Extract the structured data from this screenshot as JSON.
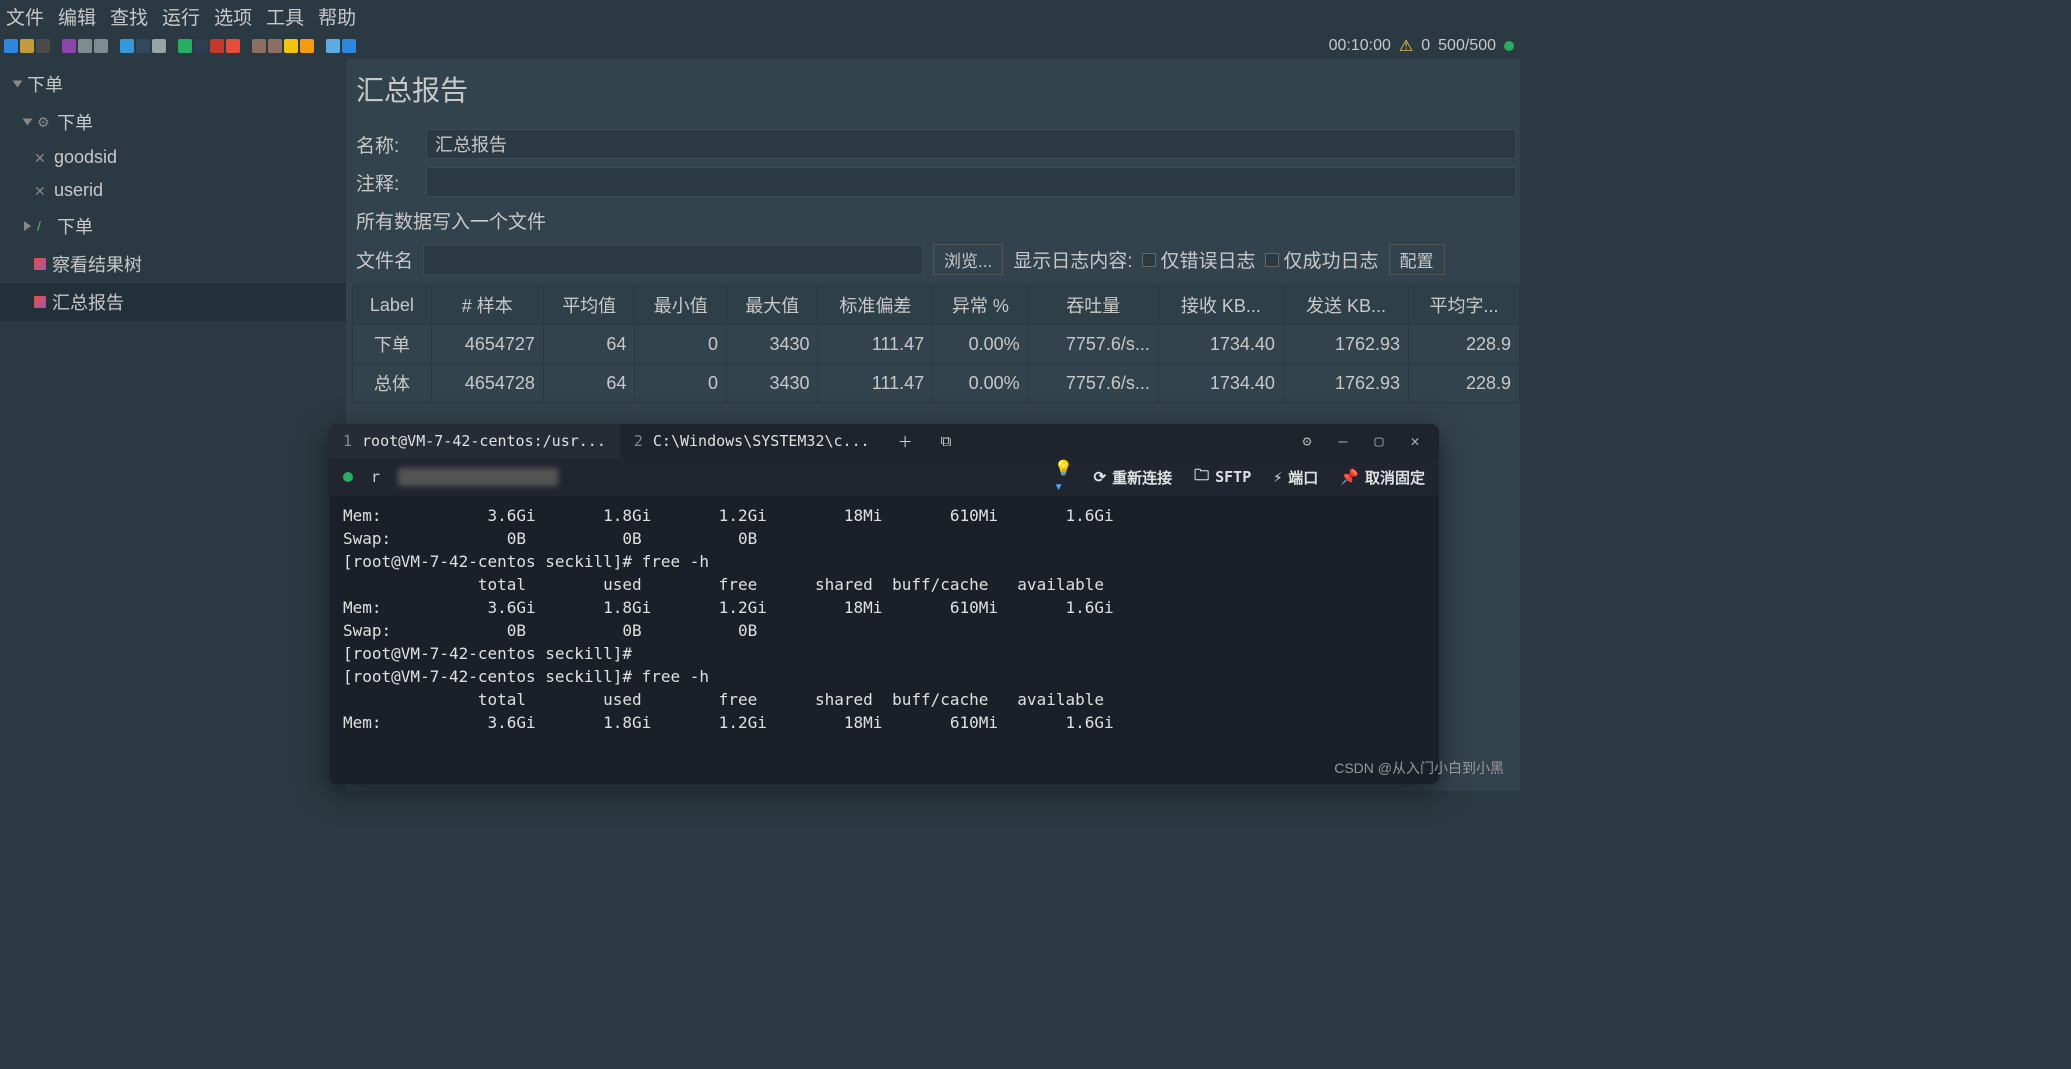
{
  "menu": [
    "文件",
    "编辑",
    "查找",
    "运行",
    "选项",
    "工具",
    "帮助"
  ],
  "status": {
    "time": "00:10:00",
    "warn": "0",
    "threads": "500/500"
  },
  "tree": {
    "root": "下单",
    "group": "下单",
    "var1": "goodsid",
    "var2": "userid",
    "sampler": "下单",
    "viewtree": "察看结果树",
    "summary": "汇总报告"
  },
  "page": {
    "title": "汇总报告",
    "name_label": "名称:",
    "name_value": "汇总报告",
    "comment_label": "注释:",
    "file_section": "所有数据写入一个文件",
    "file_label": "文件名",
    "browse_btn": "浏览...",
    "show_label": "显示日志内容:",
    "opt_err": "仅错误日志",
    "opt_ok": "仅成功日志",
    "config_btn": "配置"
  },
  "table": {
    "headers": [
      "Label",
      "# 样本",
      "平均值",
      "最小值",
      "最大值",
      "标准偏差",
      "异常 %",
      "吞吐量",
      "接收 KB...",
      "发送 KB...",
      "平均字..."
    ],
    "rows": [
      [
        "下单",
        "4654727",
        "64",
        "0",
        "3430",
        "111.47",
        "0.00%",
        "7757.6/s...",
        "1734.40",
        "1762.93",
        "228.9"
      ],
      [
        "总体",
        "4654728",
        "64",
        "0",
        "3430",
        "111.47",
        "0.00%",
        "7757.6/s...",
        "1734.40",
        "1762.93",
        "228.9"
      ]
    ]
  },
  "terminal": {
    "tab1_num": "1",
    "tab1_title": "root@VM-7-42-centos:/usr...",
    "tab2_num": "2",
    "tab2_title": "C:\\Windows\\SYSTEM32\\c...",
    "host_prefix": "r",
    "reconnect": "重新连接",
    "sftp": "SFTP",
    "port": "端口",
    "unpin": "取消固定",
    "output": "Mem:           3.6Gi       1.8Gi       1.2Gi        18Mi       610Mi       1.6Gi\nSwap:            0B          0B          0B\n[root@VM-7-42-centos seckill]# free -h\n              total        used        free      shared  buff/cache   available\nMem:           3.6Gi       1.8Gi       1.2Gi        18Mi       610Mi       1.6Gi\nSwap:            0B          0B          0B\n[root@VM-7-42-centos seckill]# \n[root@VM-7-42-centos seckill]# free -h\n              total        used        free      shared  buff/cache   available\nMem:           3.6Gi       1.8Gi       1.2Gi        18Mi       610Mi       1.6Gi"
  },
  "watermark": "CSDN @从入门小白到小黑"
}
